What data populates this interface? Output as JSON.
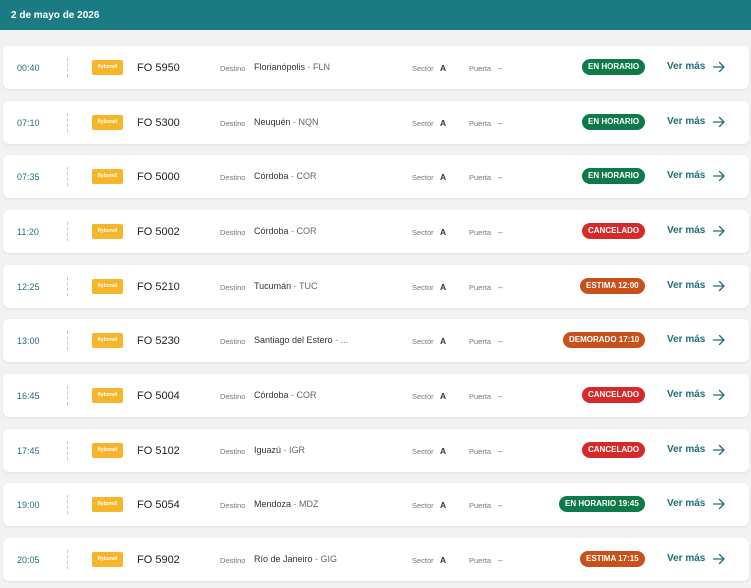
{
  "header": {
    "date": "2 de mayo de 2026"
  },
  "labels": {
    "destino": "Destino",
    "sector": "Sector",
    "puerta": "Puerta",
    "ver_mas": "Ver más",
    "airline_logo_text": "flybondi"
  },
  "colors": {
    "header_bg": "#1a7b82",
    "accent": "#1e6f78",
    "logo": "#f7b52c",
    "status_green": "#0e7a4a",
    "status_red": "#d62a2a",
    "status_orange": "#c8501b"
  },
  "flights": [
    {
      "time": "00:40",
      "flight": "FO 5950",
      "city": "Florianópolis",
      "code": "FLN",
      "sector": "A",
      "gate": "–",
      "status": "EN HORARIO",
      "status_type": "green"
    },
    {
      "time": "07:10",
      "flight": "FO 5300",
      "city": "Neuquén",
      "code": "NQN",
      "sector": "A",
      "gate": "–",
      "status": "EN HORARIO",
      "status_type": "green"
    },
    {
      "time": "07:35",
      "flight": "FO 5000",
      "city": "Córdoba",
      "code": "COR",
      "sector": "A",
      "gate": "–",
      "status": "EN HORARIO",
      "status_type": "green"
    },
    {
      "time": "11:20",
      "flight": "FO 5002",
      "city": "Córdoba",
      "code": "COR",
      "sector": "A",
      "gate": "–",
      "status": "CANCELADO",
      "status_type": "red"
    },
    {
      "time": "12:25",
      "flight": "FO 5210",
      "city": "Tucumán",
      "code": "TUC",
      "sector": "A",
      "gate": "–",
      "status": "ESTIMA 12:00",
      "status_type": "orange"
    },
    {
      "time": "13:00",
      "flight": "FO 5230",
      "city": "Santiago del Estero",
      "code": "...",
      "sector": "A",
      "gate": "–",
      "status": "DEMORADO 17:10",
      "status_type": "orange"
    },
    {
      "time": "16:45",
      "flight": "FO 5004",
      "city": "Córdoba",
      "code": "COR",
      "sector": "A",
      "gate": "–",
      "status": "CANCELADO",
      "status_type": "red"
    },
    {
      "time": "17:45",
      "flight": "FO 5102",
      "city": "Iguazú",
      "code": "IGR",
      "sector": "A",
      "gate": "–",
      "status": "CANCELADO",
      "status_type": "red"
    },
    {
      "time": "19:00",
      "flight": "FO 5054",
      "city": "Mendoza",
      "code": "MDZ",
      "sector": "A",
      "gate": "–",
      "status": "EN HORARIO 19:45",
      "status_type": "green"
    },
    {
      "time": "20:05",
      "flight": "FO 5902",
      "city": "Río de Janeiro",
      "code": "GIG",
      "sector": "A",
      "gate": "–",
      "status": "ESTIMA 17:15",
      "status_type": "orange"
    }
  ]
}
